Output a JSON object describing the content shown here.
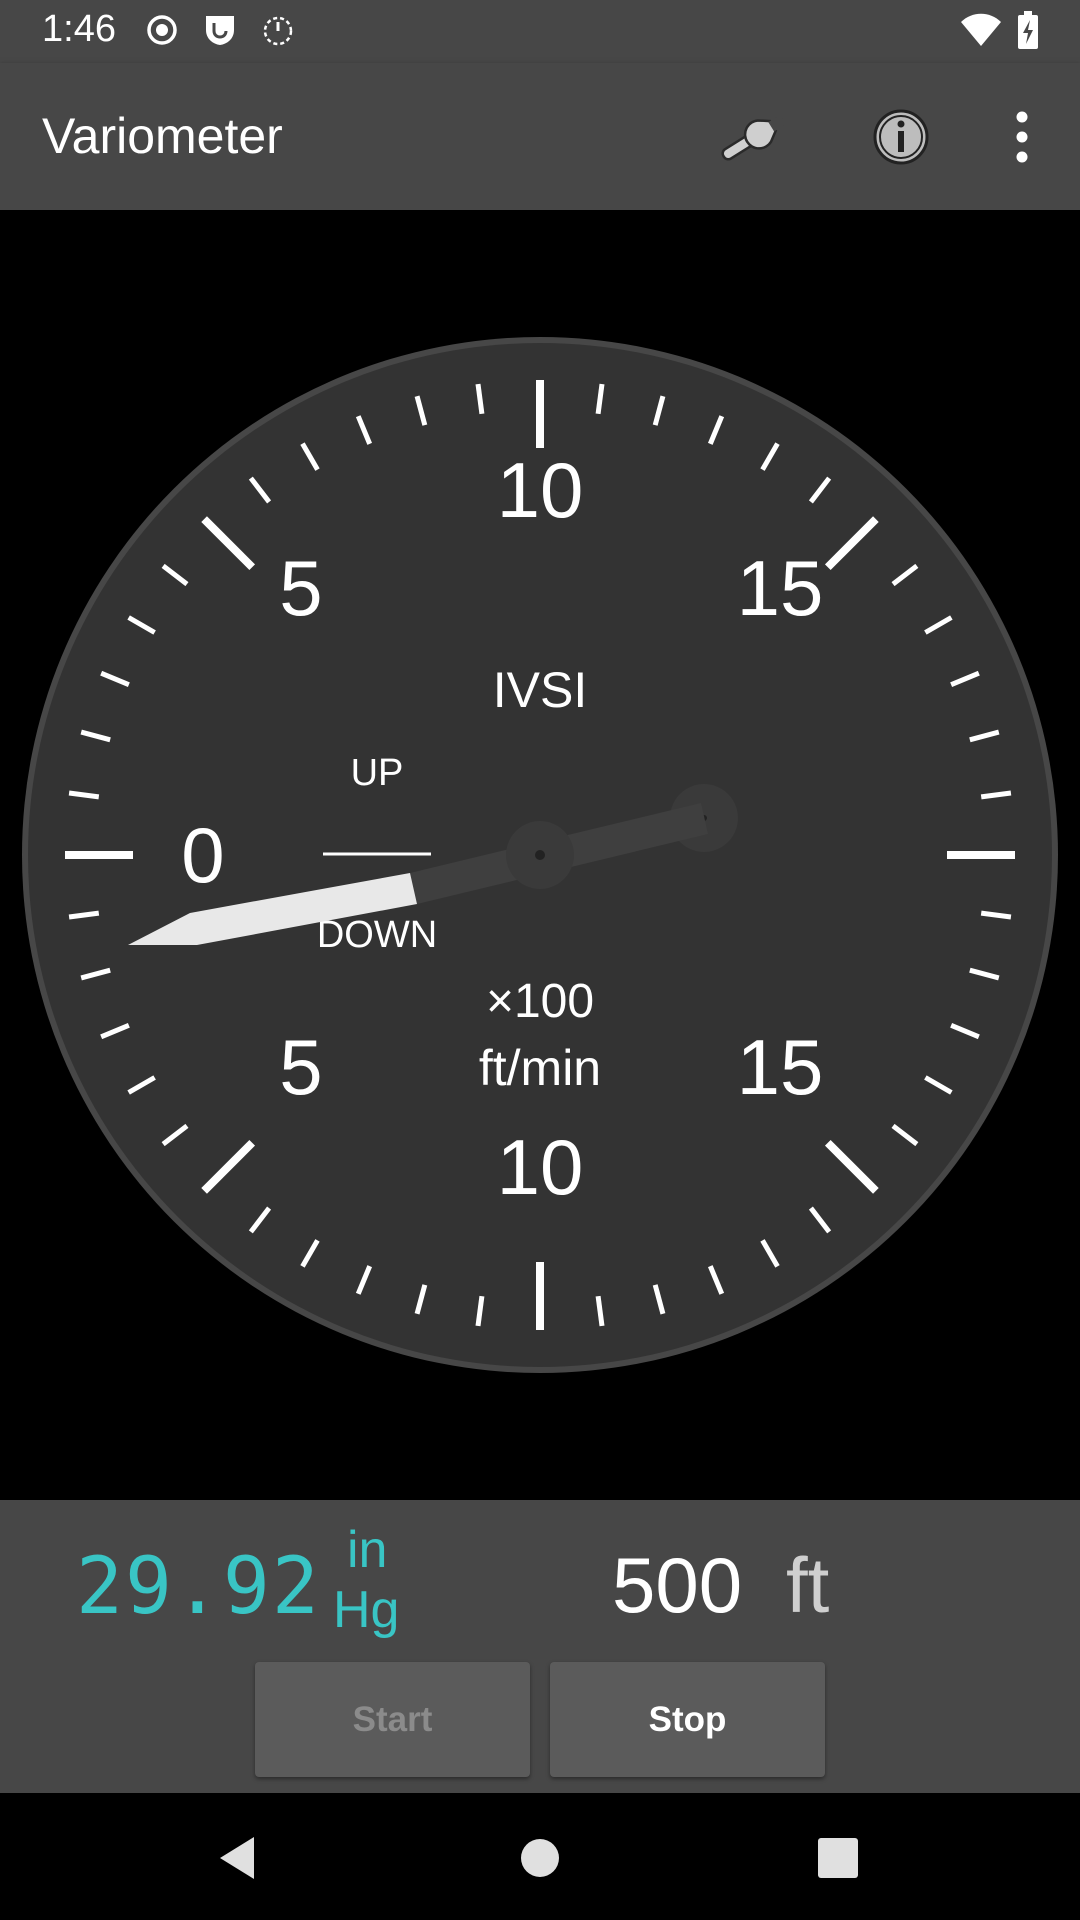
{
  "status_bar": {
    "time": "1:46",
    "icons": [
      "record-icon",
      "shield-icon",
      "timer-icon",
      "wifi-icon",
      "battery-charging-icon"
    ]
  },
  "app_bar": {
    "title": "Variometer",
    "actions": [
      "wrench-icon",
      "info-icon",
      "more-vert-icon"
    ]
  },
  "gauge": {
    "center_label": "IVSI",
    "up_label": "UP",
    "down_label": "DOWN",
    "multiplier_label": "×100",
    "unit_label": "ft/min",
    "scale_labels": {
      "zero": "0",
      "up_5": "5",
      "up_10": "10",
      "up_15": "15",
      "down_5": "5",
      "down_10": "10",
      "down_15": "15"
    },
    "needle_value_fpm_x100": -1.5,
    "colors": {
      "face": "#333333",
      "rim": "#474747",
      "needle_tip": "#e8e8e8",
      "needle_body": "#424242"
    }
  },
  "readouts": {
    "baro_value": "29.92",
    "baro_unit_line1": "in",
    "baro_unit_line2": "Hg",
    "altitude_value": "500",
    "altitude_unit": "ft",
    "accent_color": "#39c5c5"
  },
  "controls": {
    "start_label": "Start",
    "stop_label": "Stop"
  },
  "nav_bar": {
    "buttons": [
      "back-icon",
      "home-icon",
      "recents-icon"
    ]
  }
}
